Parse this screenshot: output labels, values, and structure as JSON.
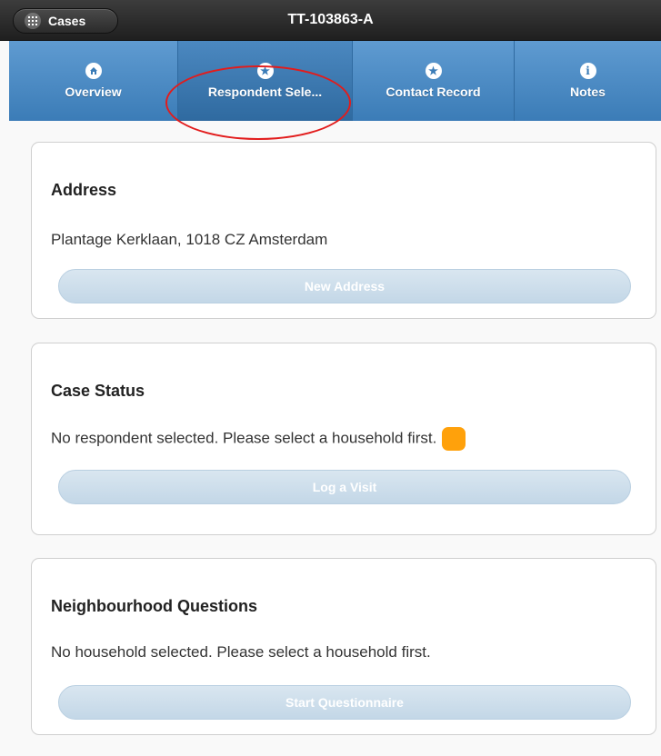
{
  "header": {
    "back_label": "Cases",
    "back_icon": "grid-icon",
    "title": "TT-103863-A"
  },
  "tabs": [
    {
      "label": "Overview",
      "icon": "home-icon"
    },
    {
      "label": "Respondent Sele...",
      "icon": "star-icon"
    },
    {
      "label": "Contact Record",
      "icon": "star-icon"
    },
    {
      "label": "Notes",
      "icon": "info-icon"
    }
  ],
  "cards": {
    "address": {
      "title": "Address",
      "text": "Plantage Kerklaan, 1018 CZ Amsterdam",
      "button": "New Address"
    },
    "case_status": {
      "title": "Case Status",
      "text": "No respondent selected. Please select a household first.",
      "button": "Log a Visit",
      "status_color": "#ffa10b"
    },
    "neighbourhood": {
      "title": "Neighbourhood Questions",
      "text": "No household selected. Please select a household first.",
      "button": "Start Questionnaire"
    }
  },
  "colors": {
    "header": "#2b2b2b",
    "tab_bar": "#4a8ac2",
    "button_disabled": "#c9dbe9",
    "annotation": "#e21c1c"
  }
}
